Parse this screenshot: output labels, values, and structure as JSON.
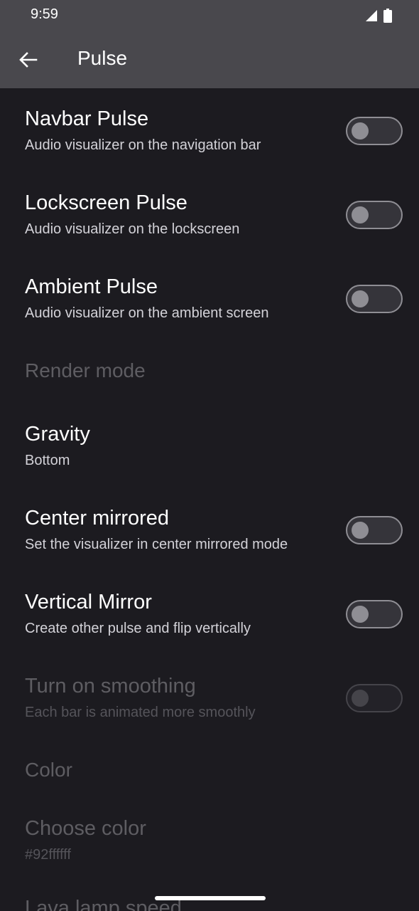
{
  "status_bar": {
    "time": "9:59"
  },
  "app_bar": {
    "title": "Pulse"
  },
  "settings": {
    "navbar_pulse": {
      "title": "Navbar Pulse",
      "summary": "Audio visualizer on the navigation bar",
      "enabled": false
    },
    "lockscreen_pulse": {
      "title": "Lockscreen Pulse",
      "summary": "Audio visualizer on the lockscreen",
      "enabled": false
    },
    "ambient_pulse": {
      "title": "Ambient Pulse",
      "summary": "Audio visualizer on the ambient screen",
      "enabled": false
    },
    "render_mode_header": "Render mode",
    "gravity": {
      "title": "Gravity",
      "summary": "Bottom"
    },
    "center_mirrored": {
      "title": "Center mirrored",
      "summary": "Set the visualizer in center mirrored mode",
      "enabled": false
    },
    "vertical_mirror": {
      "title": "Vertical Mirror",
      "summary": "Create other pulse and flip vertically",
      "enabled": false
    },
    "smoothing": {
      "title": "Turn on smoothing",
      "summary": "Each bar is animated more smoothly",
      "enabled": false
    },
    "color_header": "Color",
    "choose_color": {
      "title": "Choose color",
      "summary": "#92ffffff"
    },
    "lava_lamp_speed": {
      "title": "Lava lamp speed"
    }
  },
  "colors": {
    "background": "#1c1b20",
    "app_bar": "#49484d",
    "switch_off_track": "#35343a",
    "switch_off_outline": "#8f8e94"
  }
}
